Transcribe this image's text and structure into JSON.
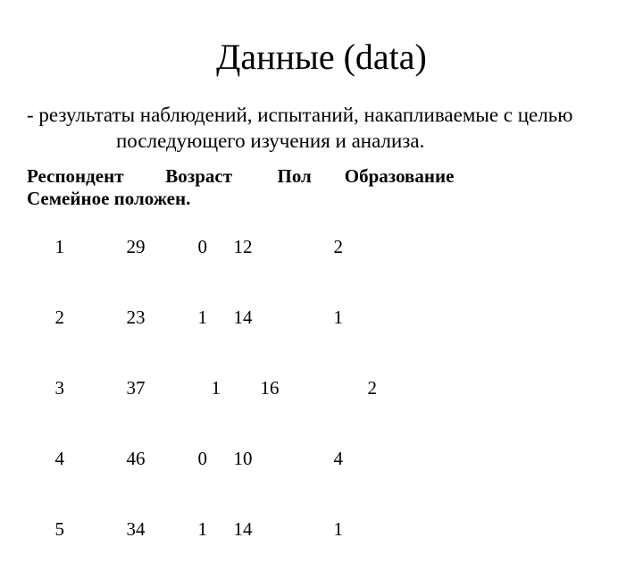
{
  "title": "Данные (data)",
  "definition_line1": "- результаты наблюдений, испытаний, накапливаемые с целью",
  "definition_line2": "последующего изучения и анализа.",
  "headers": {
    "respondent": "Респондент",
    "age": "Возраст",
    "sex": "Пол",
    "education": "Образование",
    "family": "Семейное положен."
  },
  "rows": [
    {
      "respondent": "1",
      "age": "29",
      "sex": "0",
      "education": "12",
      "family": "2"
    },
    {
      "respondent": "2",
      "age": "23",
      "sex": "1",
      "education": "14",
      "family": "1"
    },
    {
      "respondent": "3",
      "age": "37",
      "sex": "1",
      "education": "16",
      "family": "2"
    },
    {
      "respondent": "4",
      "age": "46",
      "sex": "0",
      "education": "10",
      "family": "4"
    },
    {
      "respondent": "5",
      "age": "34",
      "sex": "1",
      "education": "14",
      "family": "1"
    }
  ]
}
